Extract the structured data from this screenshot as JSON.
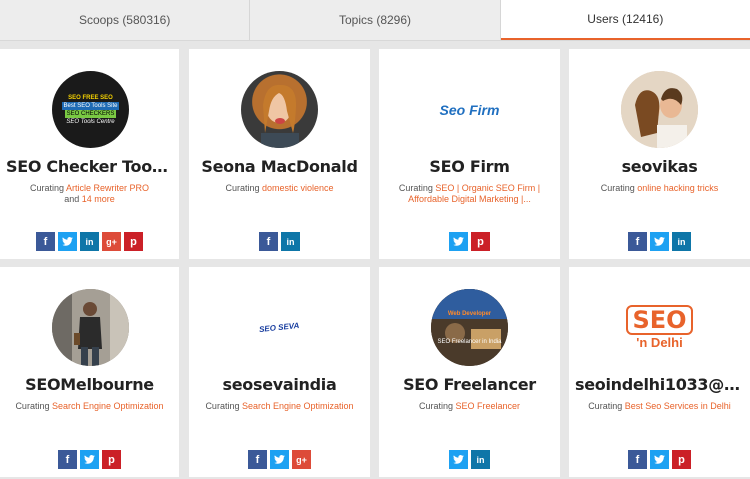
{
  "tabs": [
    {
      "label": "Scoops (580316)"
    },
    {
      "label": "Topics (8296)"
    },
    {
      "label": "Users (12416)"
    }
  ],
  "curating_prefix": "Curating",
  "and_word": "and",
  "users": [
    {
      "name": "SEO Checker Tools ...",
      "topics": "Article Rewriter PRO",
      "more": "14 more",
      "socials": [
        "facebook",
        "twitter",
        "linkedin",
        "googleplus",
        "pinterest"
      ]
    },
    {
      "name": "Seona MacDonald",
      "topics": "domestic violence",
      "more": "",
      "socials": [
        "facebook",
        "linkedin"
      ]
    },
    {
      "name": "SEO Firm",
      "topics": "SEO | Organic SEO Firm | Affordable Digital Marketing |...",
      "more": "",
      "socials": [
        "twitter",
        "pinterest"
      ]
    },
    {
      "name": "seovikas",
      "topics": "online hacking tricks",
      "more": "",
      "socials": [
        "facebook",
        "twitter",
        "linkedin"
      ]
    },
    {
      "name": "SEOMelbourne",
      "topics": "Search Engine Optimization",
      "more": "",
      "socials": [
        "facebook",
        "twitter",
        "pinterest"
      ]
    },
    {
      "name": "seosevaindia",
      "topics": "Search Engine Optimization",
      "more": "",
      "socials": [
        "facebook",
        "twitter",
        "googleplus"
      ]
    },
    {
      "name": "SEO Freelancer",
      "topics": "SEO Freelancer",
      "more": "",
      "socials": [
        "twitter",
        "linkedin"
      ]
    },
    {
      "name": "seoindelhi1033@g...",
      "topics": "Best Seo Services in Delhi",
      "more": "",
      "socials": [
        "facebook",
        "twitter",
        "pinterest"
      ]
    }
  ],
  "avatars": [
    {
      "lines": [
        "SEO FREE SEO",
        "Best SEO Tools Site",
        "SEO CHECKERS",
        "SEO Tools Centre"
      ]
    },
    {
      "lines": []
    },
    {
      "logo_text": "Seo Firm"
    },
    {
      "lines": []
    },
    {
      "lines": []
    },
    {
      "logo_text": "SEO SEVA"
    },
    {
      "lines": [
        "Web Developer",
        "SEO Freelancer in India"
      ]
    },
    {
      "logo_top": "SEO",
      "logo_bottom": "'n Delhi"
    }
  ],
  "colors": {
    "accent": "#e8632b",
    "facebook": "#3b5998",
    "twitter": "#1da1f2",
    "linkedin": "#0e76a8",
    "googleplus": "#dd4b39",
    "pinterest": "#cb2027"
  }
}
